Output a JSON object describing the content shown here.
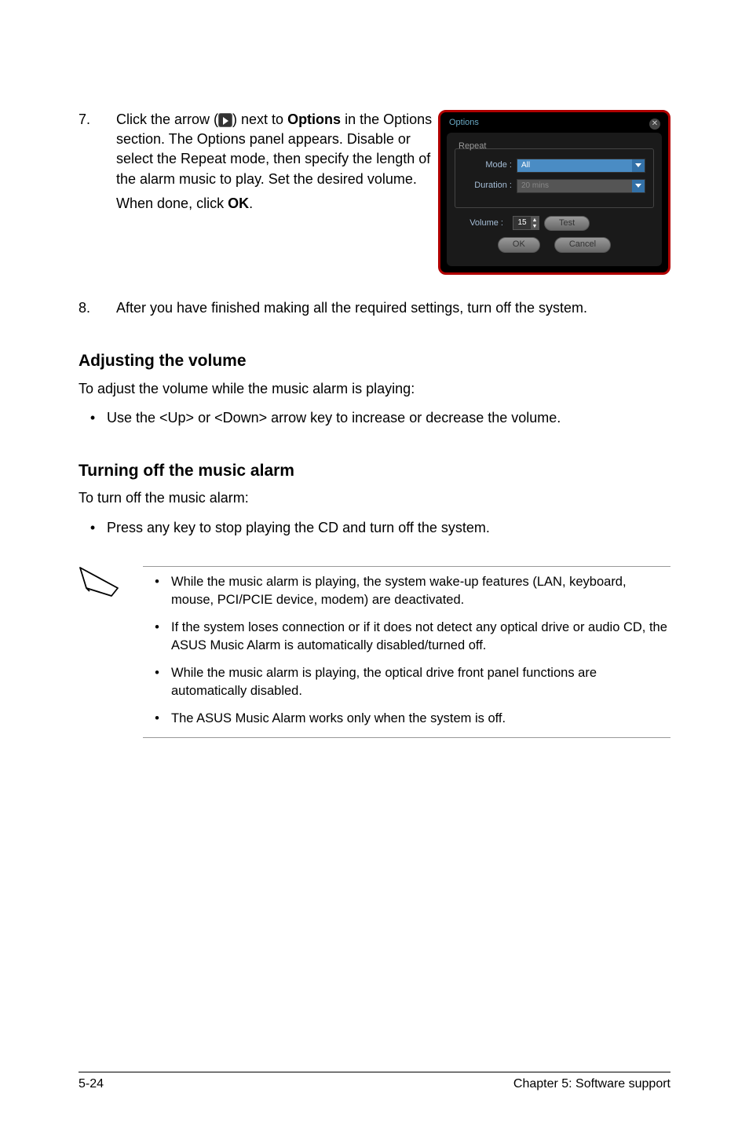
{
  "step7": {
    "num": "7.",
    "text1": "Click the arrow (",
    "text2": ") next to ",
    "bold1": "Options",
    "text3": " in the Options section. The Options panel appears. Disable or select the Repeat mode, then specify the length of the alarm music to play. Set the desired volume.",
    "text4": "When done, click ",
    "bold2": "OK",
    "text5": "."
  },
  "dialog": {
    "title": "Options",
    "close": "✕",
    "repeat_label": "Repeat",
    "mode_label": "Mode :",
    "mode_value": "All",
    "duration_label": "Duration :",
    "duration_value": "20 mins",
    "volume_label": "Volume :",
    "volume_value": "15",
    "test_btn": "Test",
    "ok_btn": "OK",
    "cancel_btn": "Cancel"
  },
  "step8": {
    "num": "8.",
    "text": "After you have finished making all the required settings, turn off the system."
  },
  "section1": {
    "title": "Adjusting the volume",
    "intro": "To adjust the volume while the music alarm is playing:",
    "bullet": "Use the  <Up> or <Down> arrow key to increase or decrease the volume."
  },
  "section2": {
    "title": "Turning off the music alarm",
    "intro": "To turn off the music alarm:",
    "bullet": "Press any key to stop playing the CD and turn off the system."
  },
  "notes": {
    "n1": "While the music alarm is playing, the system wake-up features (LAN, keyboard, mouse, PCI/PCIE device, modem) are deactivated.",
    "n2": "If the system loses connection or if it does not detect any optical drive or audio CD, the ASUS Music Alarm is automatically disabled/turned off.",
    "n3": "While the music alarm is playing, the optical drive front panel functions are automatically disabled.",
    "n4": "The ASUS Music Alarm works only when the system is off."
  },
  "footer": {
    "page": "5-24",
    "chapter": "Chapter 5: Software support"
  }
}
